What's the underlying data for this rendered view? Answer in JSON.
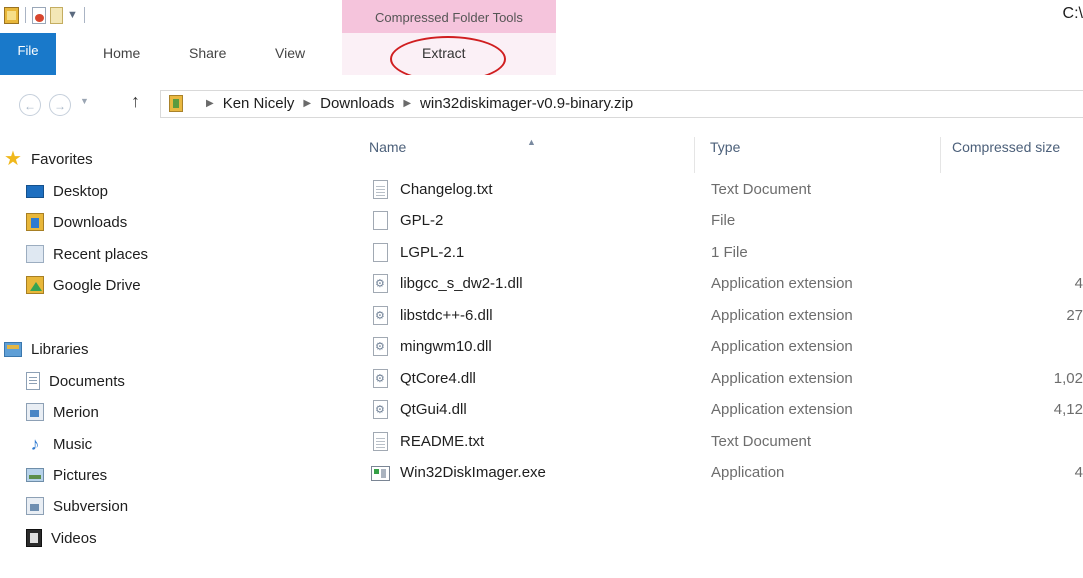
{
  "titlebar": {
    "context_group": "Compressed Folder Tools",
    "path_fragment": "C:\\"
  },
  "ribbon": {
    "tabs": {
      "file": "File",
      "home": "Home",
      "share": "Share",
      "view": "View",
      "extract": "Extract"
    },
    "annotation_color": "#d01e20"
  },
  "address": {
    "breadcrumbs": [
      "Ken Nicely",
      "Downloads",
      "win32diskimager-v0.9-binary.zip"
    ]
  },
  "nav": {
    "favorites": "Favorites",
    "favorites_items": [
      "Desktop",
      "Downloads",
      "Recent places",
      "Google Drive"
    ],
    "libraries": "Libraries",
    "libraries_items": [
      "Documents",
      "Merion",
      "Music",
      "Pictures",
      "Subversion",
      "Videos"
    ]
  },
  "columns": {
    "name": "Name",
    "type": "Type",
    "compressed_size": "Compressed size"
  },
  "files": [
    {
      "name": "Changelog.txt",
      "type": "Text Document",
      "size": "",
      "icon": "text-file-icon"
    },
    {
      "name": "GPL-2",
      "type": "File",
      "size": "",
      "icon": "blank-file-icon"
    },
    {
      "name": "LGPL-2.1",
      "type": "1 File",
      "size": "",
      "icon": "blank-file-icon"
    },
    {
      "name": "libgcc_s_dw2-1.dll",
      "type": "Application extension",
      "size": "4",
      "icon": "dll-file-icon"
    },
    {
      "name": "libstdc++-6.dll",
      "type": "Application extension",
      "size": "27",
      "icon": "dll-file-icon"
    },
    {
      "name": "mingwm10.dll",
      "type": "Application extension",
      "size": "",
      "icon": "dll-file-icon"
    },
    {
      "name": "QtCore4.dll",
      "type": "Application extension",
      "size": "1,02",
      "icon": "dll-file-icon"
    },
    {
      "name": "QtGui4.dll",
      "type": "Application extension",
      "size": "4,12",
      "icon": "dll-file-icon"
    },
    {
      "name": "README.txt",
      "type": "Text Document",
      "size": "",
      "icon": "text-file-icon"
    },
    {
      "name": "Win32DiskImager.exe",
      "type": "Application",
      "size": "4",
      "icon": "exe-file-icon"
    }
  ]
}
